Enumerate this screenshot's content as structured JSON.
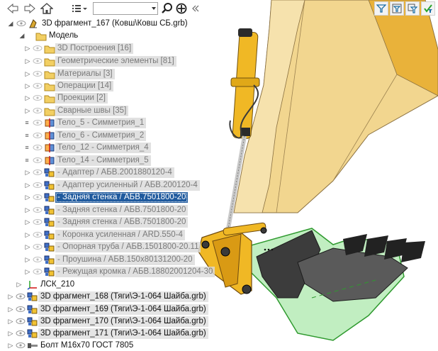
{
  "toolbar": {
    "search_value": "",
    "icons": [
      "arrow-left-icon",
      "arrow-right-icon",
      "home-icon",
      "list-menu-icon",
      "search-icon",
      "target-icon",
      "collapse-panel-icon"
    ],
    "right_icons": [
      "filter-icon",
      "filter-window-icon",
      "filter-settings-icon",
      "check-filter-icon"
    ]
  },
  "colors": {
    "selection": "#1f5a9e",
    "boom_yellow": "#f0c85a",
    "bucket_grey": "#4a4a4a",
    "highlight_green": "#43c443",
    "folder_yellow": "#f2cf63"
  },
  "tree": {
    "root": "3D фрагмент_167 (Ковш\\Ковш СБ.grb)",
    "model": "Модель",
    "folders": [
      "3D Построения [16]",
      "Геометрические элементы [81]",
      "Материалы [3]",
      "Операции [14]",
      "Проекции [2]",
      "Сварные швы [35]"
    ],
    "bodies": [
      "Тело_5 - Симметрия_1",
      "Тело_6 - Симметрия_2",
      "Тело_12 - Симметрия_4",
      "Тело_14 - Симметрия_5"
    ],
    "parts": [
      "- Адаптер / АБВ.2001880120-4",
      "- Адаптер усиленный / АБВ.200120-4",
      "- Задняя стенка / АБВ.7501800-20",
      "- Задняя стенка / АБВ.7501800-20",
      "- Задняя стенка / АБВ.7501800-20",
      "- Коронка усиленная / ARD.550-4",
      "- Опорная труба / АБВ.1501800-20.11",
      "- Проушина / АБВ.150х80131200-20",
      "- Режущая кромка / АБВ.18802001204-30"
    ],
    "lcs": "ЛСК_210",
    "fragments": [
      "3D фрагмент_168 (Тяги\\Э-1-064 Шайба.grb)",
      "3D фрагмент_169 (Тяги\\Э-1-064 Шайба.grb)",
      "3D фрагмент_170 (Тяги\\Э-1-064 Шайба.grb)",
      "3D фрагмент_171 (Тяги\\Э-1-064 Шайба.grb)"
    ],
    "bolt": "Болт М16х70 ГОСТ 7805"
  }
}
